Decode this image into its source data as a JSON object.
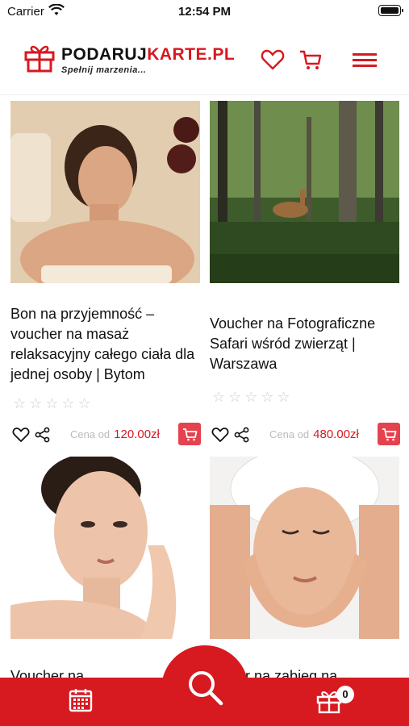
{
  "status_bar": {
    "carrier": "Carrier",
    "time": "12:54 PM"
  },
  "header": {
    "brand_part1": "PODARUJ",
    "brand_part2": "KARTE.PL",
    "tagline": "Spełnij marzenia...",
    "icons": [
      "heart-icon",
      "cart-icon",
      "hamburger-menu-icon"
    ]
  },
  "products": [
    {
      "title": "Bon na przyjemność – voucher na masaż relaksacyjny całego ciała dla jednej osoby | Bytom",
      "price_prefix": "Cena od",
      "price": "120.00zł",
      "rating": "☆☆☆☆☆"
    },
    {
      "title": "Voucher na Fotograficzne Safari wśród zwierząt | Warszawa",
      "price_prefix": "Cena od",
      "price": "480.00zł",
      "rating": "☆☆☆☆☆"
    },
    {
      "title": "Voucher na ...",
      "price_prefix": "",
      "price": "",
      "rating": ""
    },
    {
      "title": "...cher na zabieg na",
      "price_prefix": "",
      "price": "",
      "rating": ""
    }
  ],
  "bottom_bar": {
    "cart_count": "0",
    "icons": [
      "calendar-icon",
      "search-icon",
      "gift-icon"
    ]
  },
  "colors": {
    "brand_red": "#d71920",
    "cart_button": "#e5424f",
    "price_prefix_gray": "#bbbbbb"
  }
}
